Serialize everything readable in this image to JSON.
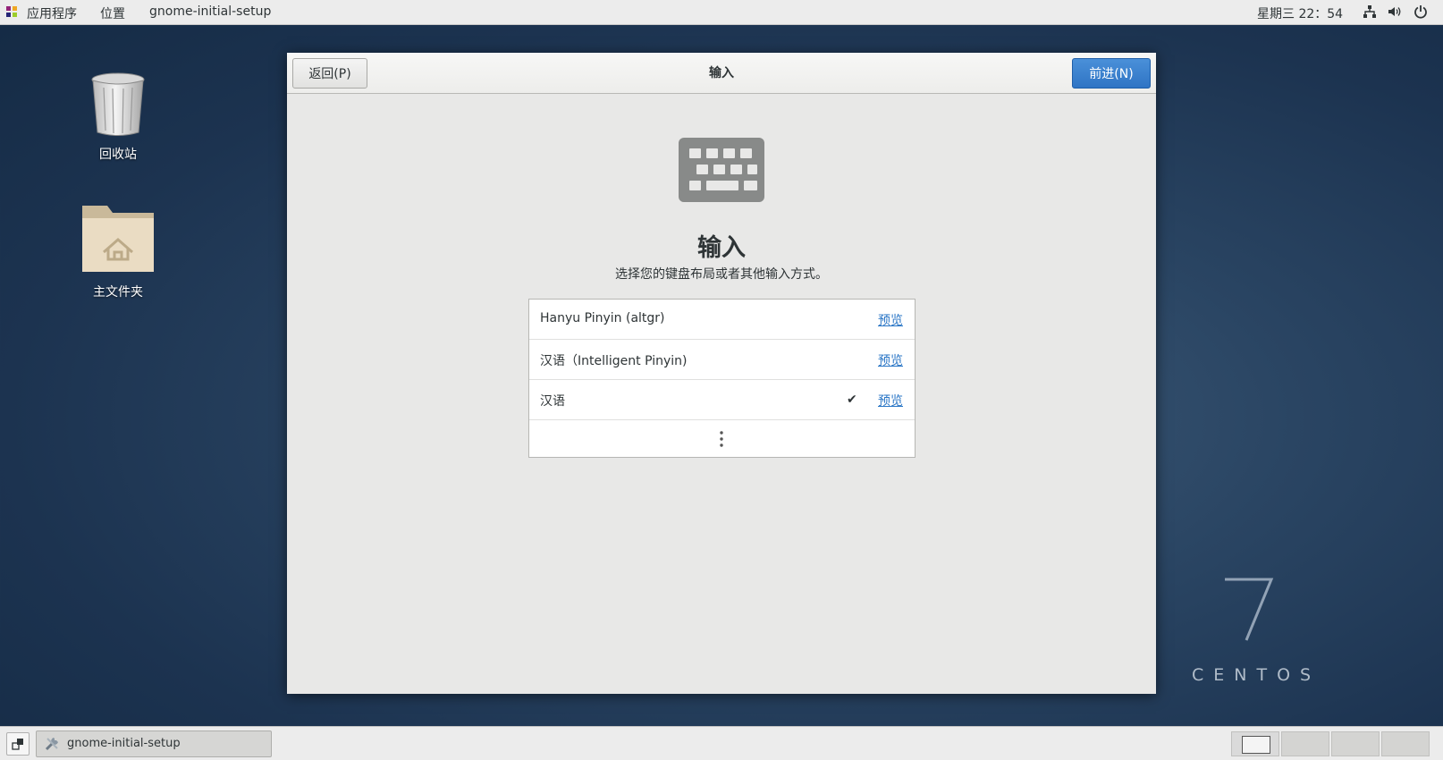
{
  "topbar": {
    "applications": "应用程序",
    "places": "位置",
    "active_app": "gnome-initial-setup",
    "clock": "星期三 22：54"
  },
  "desktop": {
    "icons": [
      {
        "label": "回收站",
        "icon": "trash-icon"
      },
      {
        "label": "主文件夹",
        "icon": "home-folder-icon"
      }
    ],
    "branding": {
      "version": "7",
      "name": "CENTOS"
    }
  },
  "dialog": {
    "back_label": "返回(P)",
    "title": "输入",
    "next_label": "前进(N)",
    "heading": "输入",
    "subtitle": "选择您的键盘布局或者其他输入方式。",
    "input_sources": [
      {
        "name": "Hanyu Pinyin (altgr)",
        "preview": "预览",
        "selected": false
      },
      {
        "name": "汉语（Intelligent Pinyin)",
        "preview": "预览",
        "selected": false
      },
      {
        "name": "汉语",
        "preview": "预览",
        "selected": true
      }
    ],
    "more_icon": "more-vertical-icon",
    "accent_color": "#3080cf"
  },
  "taskbar": {
    "task_label": "gnome-initial-setup",
    "workspaces": 4,
    "active_workspace": 1
  }
}
